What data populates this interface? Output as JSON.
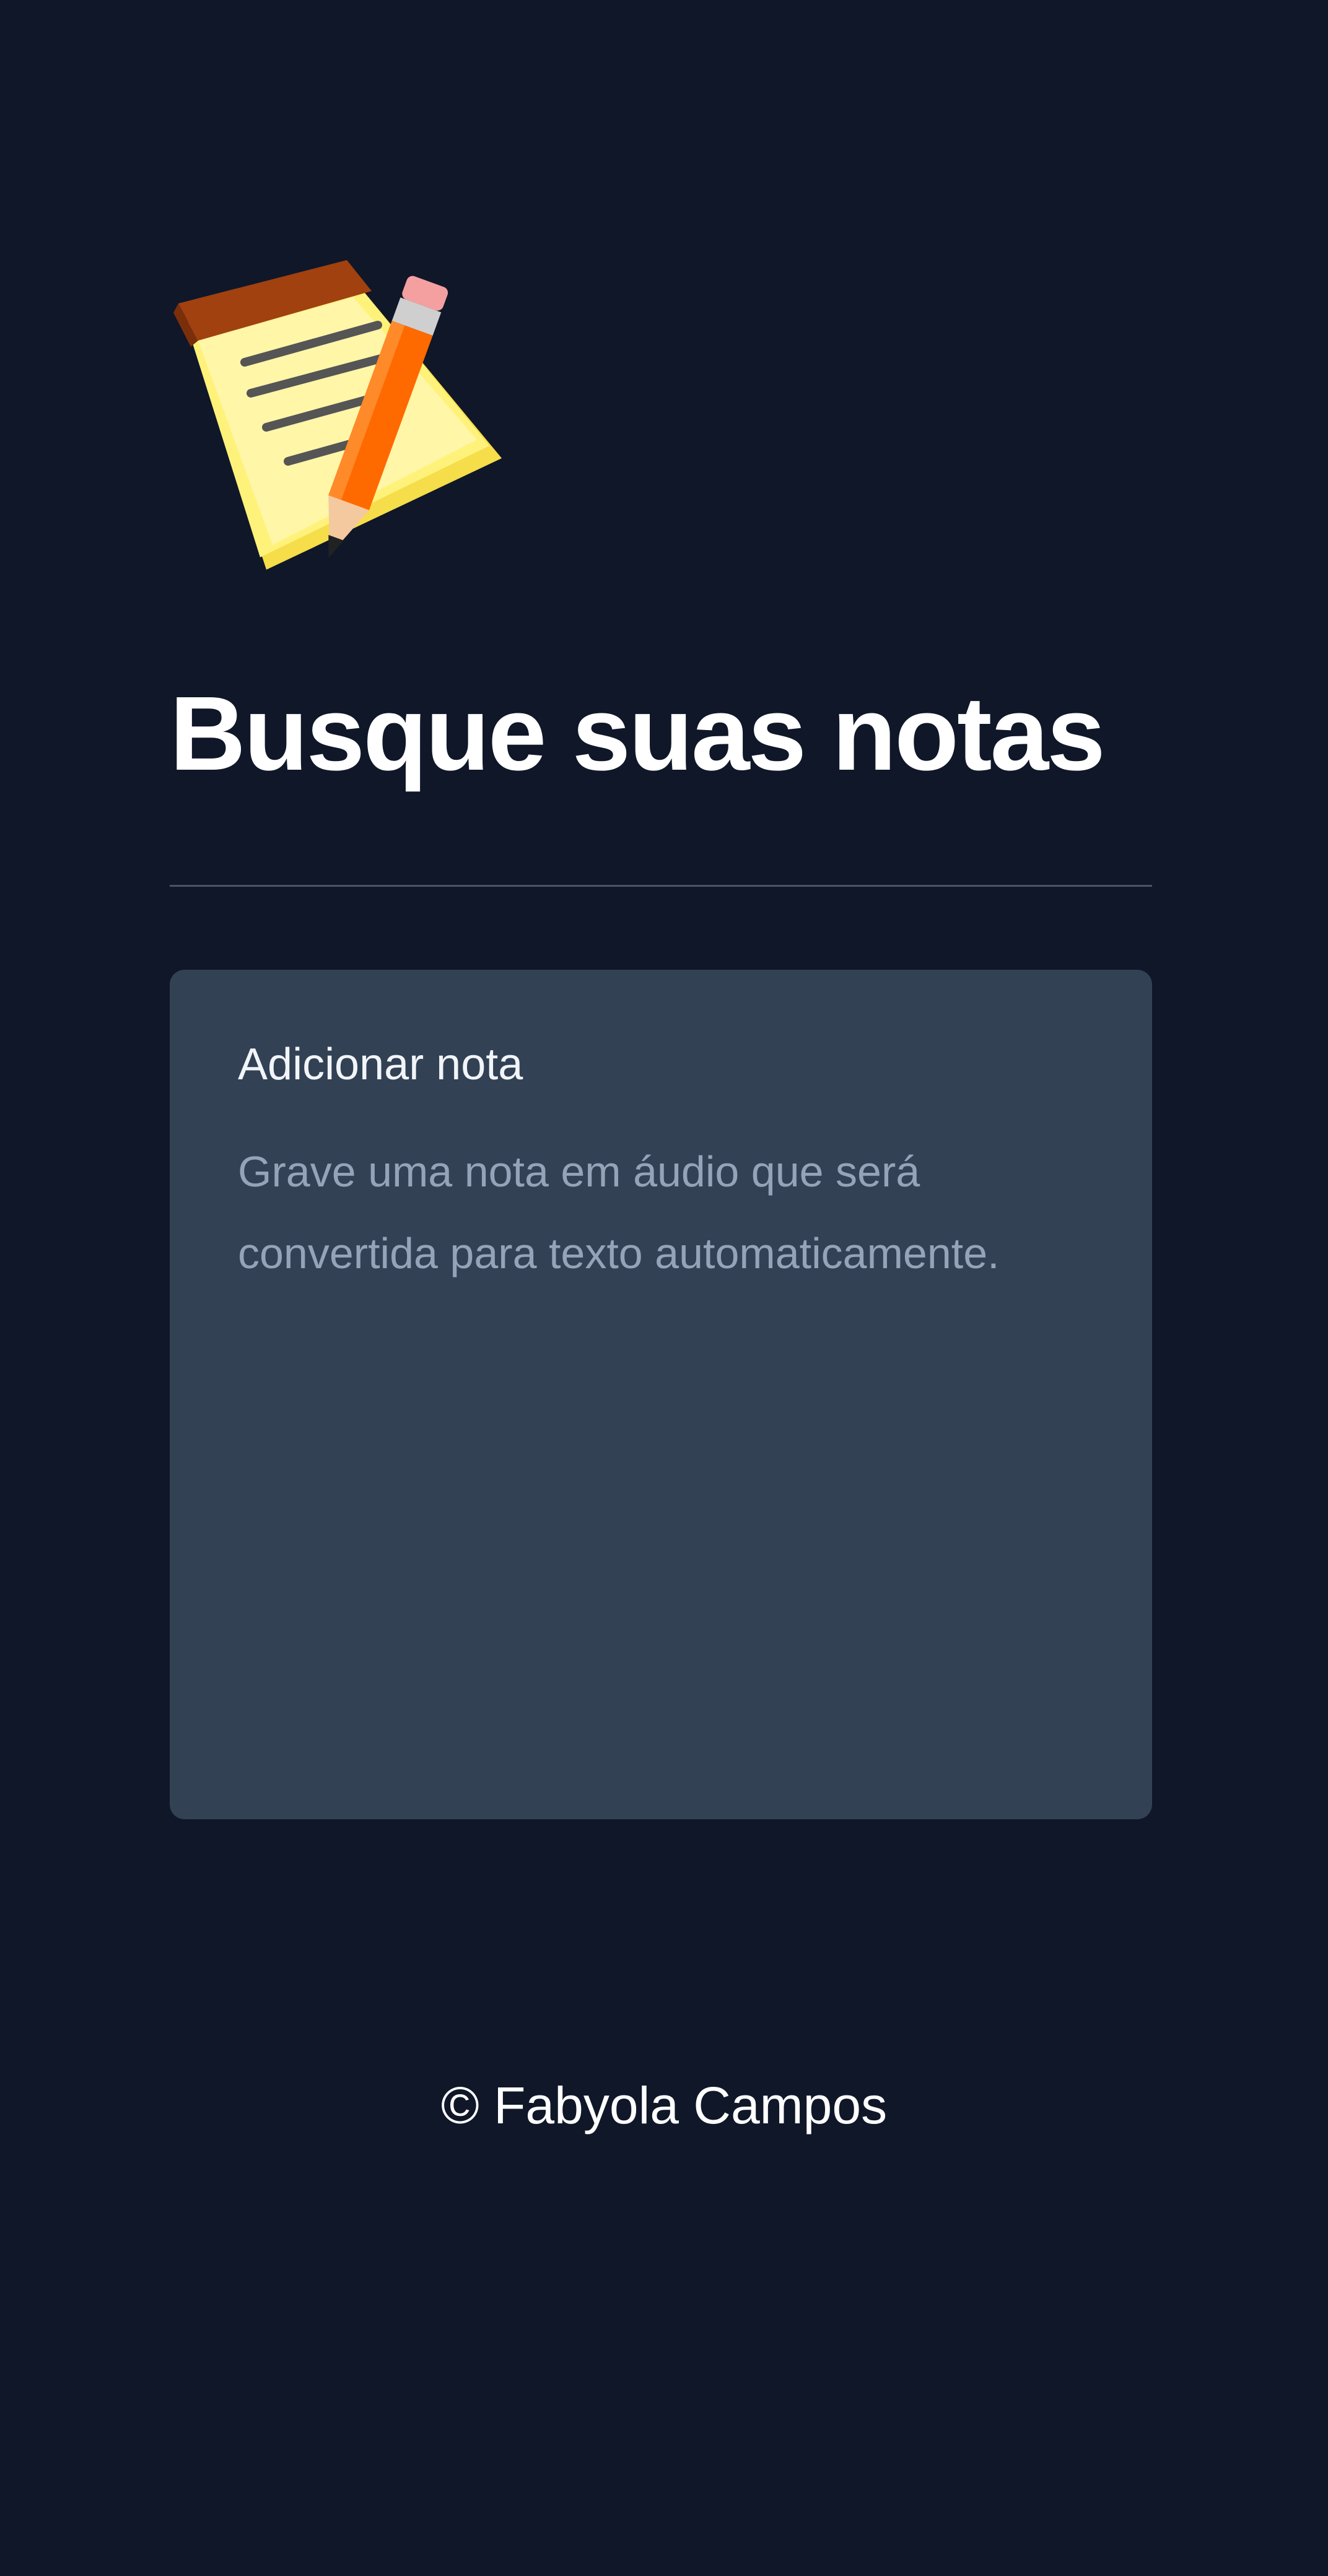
{
  "header": {
    "logo_icon": "notepad-pencil-icon",
    "title": "Busque suas notas"
  },
  "note_card": {
    "title": "Adicionar nota",
    "description": "Grave uma nota em áudio que será convertida para texto automaticamente."
  },
  "footer": {
    "text": "© Fabyola Campos"
  },
  "colors": {
    "background": "#0f1729",
    "card": "#334155",
    "title_text": "#ffffff",
    "card_description": "#94a3b8",
    "divider": "#4b5563"
  }
}
